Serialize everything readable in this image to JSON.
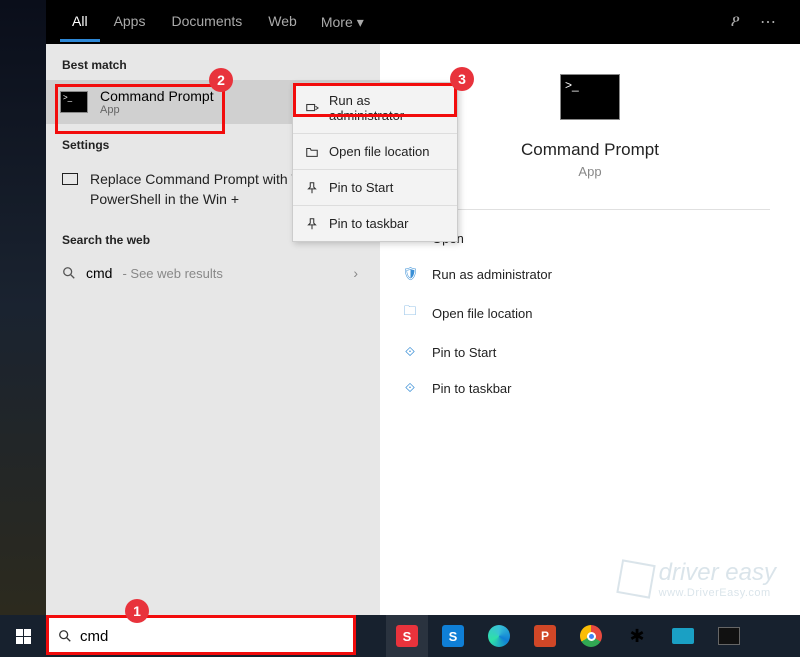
{
  "nav": {
    "tabs": [
      "All",
      "Apps",
      "Documents",
      "Web",
      "More"
    ],
    "active": 0
  },
  "left": {
    "best_match_header": "Best match",
    "best_match": {
      "title": "Command Prompt",
      "subtitle": "App"
    },
    "settings_header": "Settings",
    "settings_item": "Replace Command Prompt with Windows PowerShell in the Win +",
    "search_web_header": "Search the web",
    "web_item": {
      "term": "cmd",
      "suffix": " - See web results"
    }
  },
  "context_menu": {
    "items": [
      "Run as administrator",
      "Open file location",
      "Pin to Start",
      "Pin to taskbar"
    ]
  },
  "preview": {
    "title": "Command Prompt",
    "subtitle": "App",
    "actions": [
      "Open",
      "Run as administrator",
      "Open file location",
      "Pin to Start",
      "Pin to taskbar"
    ]
  },
  "search": {
    "value": "cmd"
  },
  "watermark": {
    "brand": "driver easy",
    "url": "www.DriverEasy.com"
  },
  "badges": {
    "b1": "1",
    "b2": "2",
    "b3": "3"
  }
}
